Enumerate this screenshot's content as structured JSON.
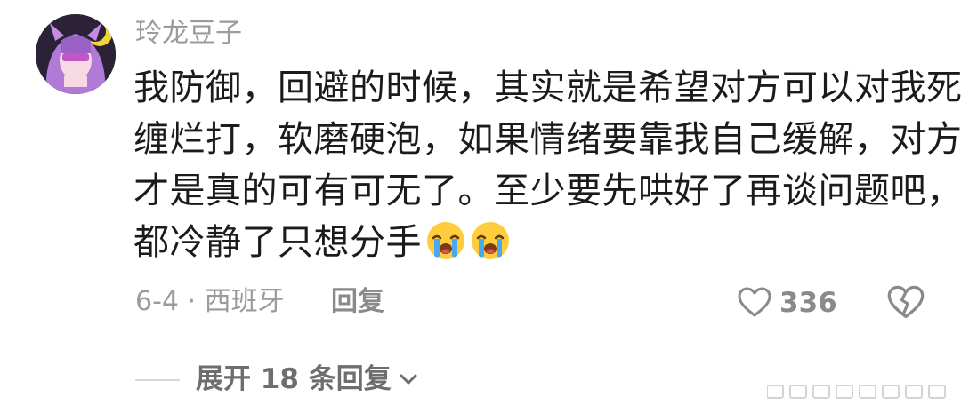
{
  "comment": {
    "username": "玲龙豆子",
    "lines": [
      "我防御，回避的时候，其实就是希望对方可以对我死",
      "缠烂打，软磨硬泡，如果情绪要靠我自己缓解，对方",
      "才是真的可有可无了。至少要先哄好了再谈问题吧，",
      "都冷静了只想分手"
    ],
    "emojis": [
      "loudly-crying-face-icon",
      "loudly-crying-face-icon"
    ],
    "meta": "6-4 · 西班牙",
    "reply_label": "回复",
    "like_count": "336",
    "expand_label": "展开 18 条回复"
  },
  "colors": {
    "text": "#1b1b1b",
    "muted": "#9b9b9b",
    "avatar_purple": "#b07ad6"
  }
}
